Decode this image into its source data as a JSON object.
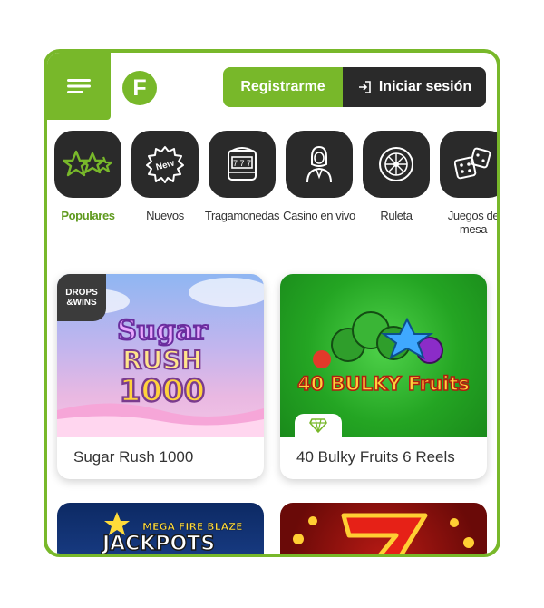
{
  "header": {
    "menu_icon": "menu-icon",
    "logo_letter": "F",
    "register_label": "Registrarme",
    "login_label": "Iniciar sesión",
    "login_icon": "login-icon"
  },
  "categories": [
    {
      "label": "Populares",
      "icon": "stars-icon",
      "active": true
    },
    {
      "label": "Nuevos",
      "icon": "new-badge-icon"
    },
    {
      "label": "Tragamonedas",
      "icon": "slot-machine-icon"
    },
    {
      "label": "Casino en vivo",
      "icon": "live-dealer-icon"
    },
    {
      "label": "Ruleta",
      "icon": "roulette-icon"
    },
    {
      "label": "Juegos de mesa",
      "icon": "dice-icon"
    }
  ],
  "games": [
    {
      "title": "Sugar Rush 1000",
      "badge": "DROPS & WINS",
      "art_title": "Sugar RUSH 1000"
    },
    {
      "title": "40 Bulky Fruits 6 Reels",
      "badge_icon": "diamond-icon",
      "art_title": "40 BULKY Fruits"
    },
    {
      "art_title": "MEGA FIRE BLAZE JACKPOTS"
    },
    {
      "art_title": "7"
    }
  ],
  "colors": {
    "accent": "#78b82a",
    "dark": "#2a2a2a"
  }
}
